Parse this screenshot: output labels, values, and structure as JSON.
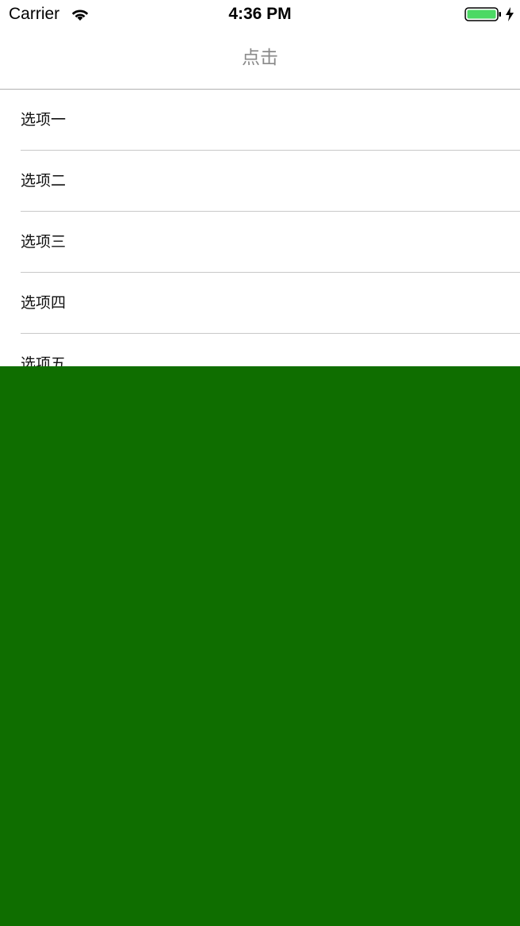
{
  "status_bar": {
    "carrier": "Carrier",
    "time": "4:36 PM",
    "wifi_icon": "wifi-icon",
    "battery_icon": "battery-icon",
    "charging_icon": "charging-bolt-icon",
    "battery_color": "#4cd964"
  },
  "nav": {
    "title": "点击"
  },
  "list": {
    "items": [
      {
        "label": "选项一"
      },
      {
        "label": "选项二"
      },
      {
        "label": "选项三"
      },
      {
        "label": "选项四"
      },
      {
        "label": "选项五"
      }
    ]
  },
  "colors": {
    "panel": "#0f6e00",
    "divider": "#c8c8c8",
    "nav_title": "#8a8a8a"
  }
}
